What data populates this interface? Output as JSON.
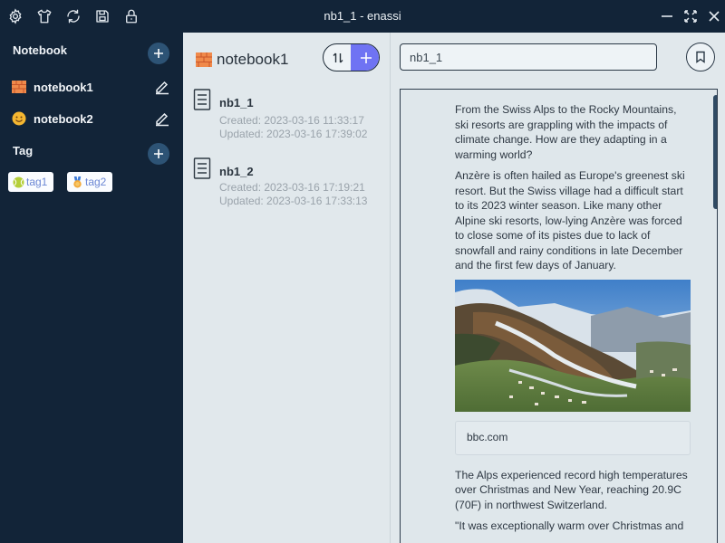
{
  "window": {
    "title": "nb1_1 - enassi"
  },
  "toolbar_icons": [
    "gear-icon",
    "shirt-icon",
    "sync-icon",
    "save-icon",
    "lock-icon"
  ],
  "sidebar": {
    "notebook_header": "Notebook",
    "notebooks": [
      {
        "label": "notebook1",
        "emoji": "brick-icon"
      },
      {
        "label": "notebook2",
        "emoji": "smile-icon"
      }
    ],
    "tag_header": "Tag",
    "tags": [
      {
        "label": "tag1",
        "emoji": "tennis-ball-icon"
      },
      {
        "label": "tag2",
        "emoji": "medal-icon"
      }
    ]
  },
  "note_list": {
    "notebook_title": "notebook1",
    "notes": [
      {
        "name": "nb1_1",
        "created": "Created: 2023-03-16 11:33:17",
        "updated": "Updated: 2023-03-16 17:39:02"
      },
      {
        "name": "nb1_2",
        "created": "Created: 2023-03-16 17:19:21",
        "updated": "Updated: 2023-03-16 17:33:13"
      }
    ]
  },
  "editor": {
    "title_value": "nb1_1",
    "paragraphs": [
      "From the Swiss Alps to the Rocky Mountains, ski resorts are grappling with the impacts of climate change. How are they adapting in a warming world?",
      "Anzère is often hailed as Europe's greenest ski resort. But the Swiss village had a difficult start to its 2023 winter season. Like many other Alpine ski resorts, low-lying Anzère was forced to close some of its pistes due to lack of snowfall and rainy conditions in late December and the first few days of January."
    ],
    "link_card": "bbc.com",
    "paragraphs_after": [
      "The Alps experienced record high temperatures over Christmas and New Year, reaching 20.9C (70F) in northwest Switzerland.",
      "\"It was exceptionally warm over Christmas and"
    ]
  },
  "colors": {
    "sidebar_bg": "#122438",
    "panel_bg": "#e1e8ec",
    "accent": "#6f73f3",
    "add_circle": "#2d5375"
  }
}
